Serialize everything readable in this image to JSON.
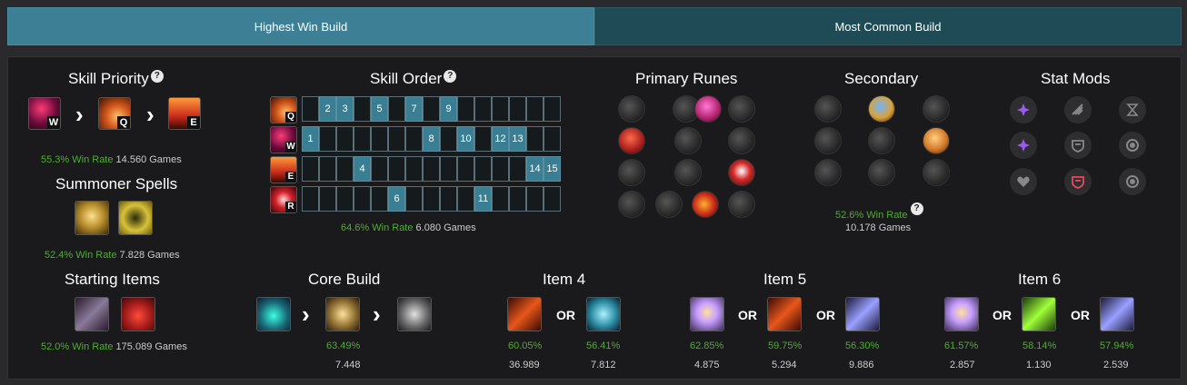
{
  "tabs": {
    "highest": "Highest Win Build",
    "common": "Most Common Build"
  },
  "skill_priority": {
    "title": "Skill Priority",
    "help": "?",
    "skills": [
      {
        "key": "W"
      },
      {
        "key": "Q"
      },
      {
        "key": "E"
      }
    ],
    "win_rate": "55.3% Win Rate",
    "games": "14.560 Games"
  },
  "summoner_spells": {
    "title": "Summoner Spells",
    "win_rate": "52.4% Win Rate",
    "games": "7.828 Games"
  },
  "skill_order": {
    "title": "Skill Order",
    "help": "?",
    "rows": [
      {
        "key": "Q",
        "cells": [
          "",
          "2",
          "3",
          "",
          "5",
          "",
          "7",
          "",
          "9",
          "",
          "",
          "",
          "",
          "",
          ""
        ]
      },
      {
        "key": "W",
        "cells": [
          "1",
          "",
          "",
          "",
          "",
          "",
          "",
          "8",
          "",
          "10",
          "",
          "12",
          "13",
          "",
          ""
        ]
      },
      {
        "key": "E",
        "cells": [
          "",
          "",
          "",
          "4",
          "",
          "",
          "",
          "",
          "",
          "",
          "",
          "",
          "",
          "14",
          "15"
        ]
      },
      {
        "key": "R",
        "cells": [
          "",
          "",
          "",
          "",
          "",
          "6",
          "",
          "",
          "",
          "",
          "11",
          "",
          "",
          "",
          ""
        ]
      }
    ],
    "win_rate": "64.6% Win Rate",
    "games": "6.080 Games"
  },
  "primary_runes": {
    "title": "Primary Runes"
  },
  "secondary": {
    "title": "Secondary",
    "help": "?",
    "win_rate": "52.6% Win Rate",
    "games": "10.178 Games"
  },
  "stat_mods": {
    "title": "Stat Mods"
  },
  "starting_items": {
    "title": "Starting Items",
    "win_rate": "52.0% Win Rate",
    "games": "175.089 Games"
  },
  "core_build": {
    "title": "Core Build",
    "pct": "63.49%",
    "games": "7.448"
  },
  "item4": {
    "title": "Item 4",
    "or": "OR",
    "options": [
      {
        "pct": "60.05%",
        "games": "36.989"
      },
      {
        "pct": "56.41%",
        "games": "7.812"
      }
    ]
  },
  "item5": {
    "title": "Item 5",
    "or": "OR",
    "options": [
      {
        "pct": "62.85%",
        "games": "4.875"
      },
      {
        "pct": "59.75%",
        "games": "5.294"
      },
      {
        "pct": "56.30%",
        "games": "9.886"
      }
    ]
  },
  "item6": {
    "title": "Item 6",
    "or": "OR",
    "options": [
      {
        "pct": "61.57%",
        "games": "2.857"
      },
      {
        "pct": "58.14%",
        "games": "1.130"
      },
      {
        "pct": "57.94%",
        "games": "2.539"
      }
    ]
  },
  "colors": {
    "accent": "#3d7f95",
    "win_green": "#4caf2e",
    "cell_on": "#3a7e93"
  }
}
